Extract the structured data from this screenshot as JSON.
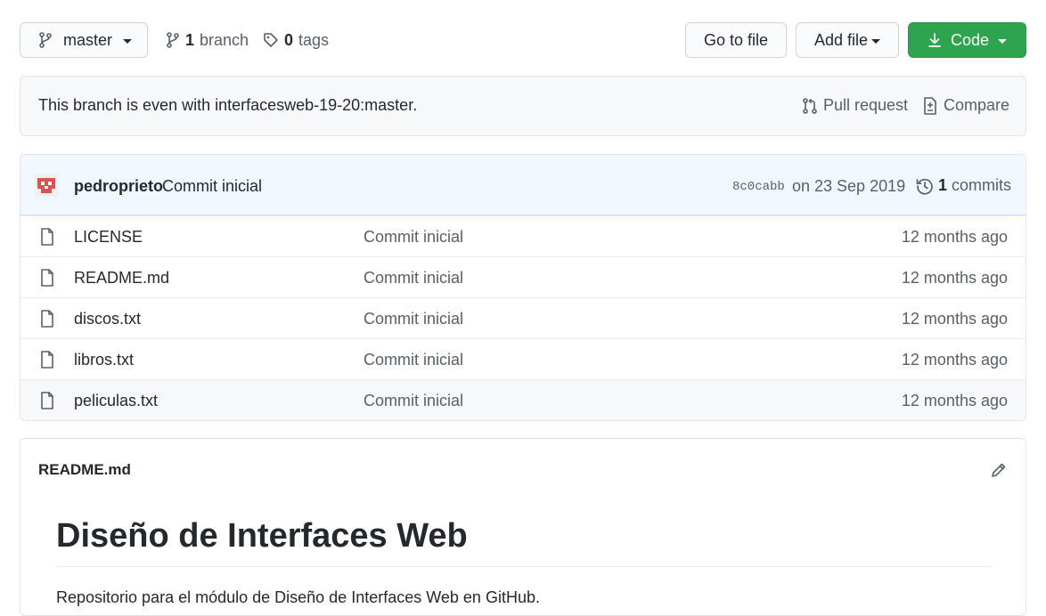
{
  "toolbar": {
    "branch_name": "master",
    "branch_count": "1",
    "branch_label": "branch",
    "tag_count": "0",
    "tag_label": "tags",
    "go_to_file": "Go to file",
    "add_file": "Add file",
    "code": "Code"
  },
  "status": {
    "message": "This branch is even with interfacesweb-19-20:master.",
    "pull_request": "Pull request",
    "compare": "Compare"
  },
  "commit": {
    "author": "pedroprieto",
    "message": "Commit inicial",
    "sha": "8c0cabb",
    "date": "on 23 Sep 2019",
    "count": "1",
    "count_label": "commits"
  },
  "files": [
    {
      "name": "LICENSE",
      "commit": "Commit inicial",
      "age": "12 months ago"
    },
    {
      "name": "README.md",
      "commit": "Commit inicial",
      "age": "12 months ago"
    },
    {
      "name": "discos.txt",
      "commit": "Commit inicial",
      "age": "12 months ago"
    },
    {
      "name": "libros.txt",
      "commit": "Commit inicial",
      "age": "12 months ago"
    },
    {
      "name": "peliculas.txt",
      "commit": "Commit inicial",
      "age": "12 months ago"
    }
  ],
  "readme": {
    "filename": "README.md",
    "heading": "Diseño de Interfaces Web",
    "paragraph": "Repositorio para el módulo de Diseño de Interfaces Web en GitHub."
  },
  "icons": {
    "branch": "git-branch-icon",
    "tag": "tag-icon",
    "download": "download-icon",
    "pull_request": "pull-request-icon",
    "compare": "diff-icon",
    "history": "history-icon",
    "file": "file-icon",
    "edit": "pencil-icon"
  },
  "colors": {
    "code_button": "#2ea44f",
    "commit_bar": "#f1f8ff",
    "avatar": "#d9534f"
  }
}
